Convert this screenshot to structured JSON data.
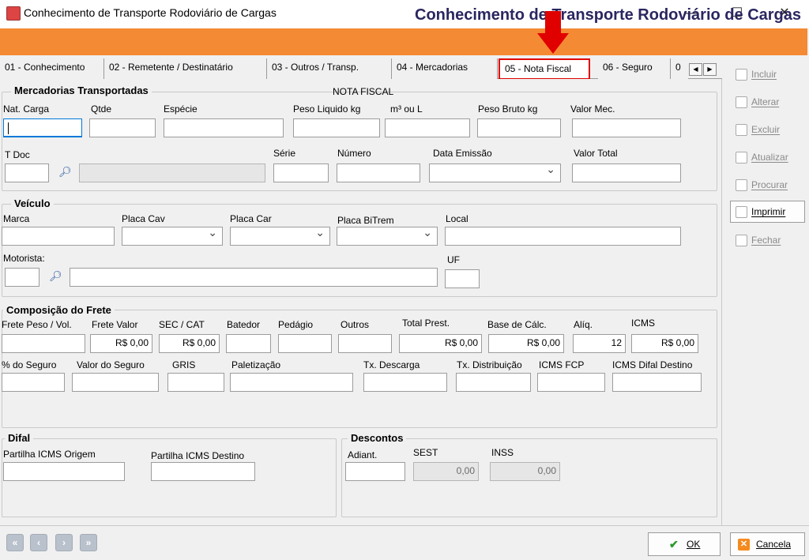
{
  "window": {
    "title": "Conhecimento de Transporte Rodoviário de Cargas",
    "minimize": "—",
    "maximize": "☐",
    "close": "✕"
  },
  "banner": {
    "title": "Conhecimento de Transporte Rodoviário de Cargas"
  },
  "tabs": [
    {
      "label": "01 - Conhecimento"
    },
    {
      "label": "02 - Remetente / Destinatário"
    },
    {
      "label": "03 - Outros / Transp."
    },
    {
      "label": "04 - Mercadorias"
    },
    {
      "label": "05 - Nota Fiscal",
      "active": true
    },
    {
      "label": "06 - Seguro"
    },
    {
      "label": "0"
    }
  ],
  "tab_scroll": {
    "left": "◀",
    "right": "▶"
  },
  "mercadorias": {
    "title": "Mercadorias Transportadas",
    "nota_fiscal_header": "NOTA FISCAL",
    "nat_carga": {
      "label": "Nat. Carga",
      "value": ""
    },
    "qtde": {
      "label": "Qtde",
      "value": ""
    },
    "especie": {
      "label": "Espécie",
      "value": ""
    },
    "peso_liquido": {
      "label": "Peso Liquido kg",
      "value": ""
    },
    "m3_ou_l": {
      "label": "m³ ou L",
      "value": ""
    },
    "peso_bruto": {
      "label": "Peso Bruto kg",
      "value": ""
    },
    "valor_mec": {
      "label": "Valor Mec.",
      "value": ""
    },
    "t_doc": {
      "label": "T Doc",
      "value": ""
    },
    "serie": {
      "label": "Série",
      "value": ""
    },
    "numero": {
      "label": "Número",
      "value": ""
    },
    "data_emissao": {
      "label": "Data Emissão",
      "value": ""
    },
    "valor_total": {
      "label": "Valor Total",
      "value": ""
    }
  },
  "veiculo": {
    "title": "Veículo",
    "marca": {
      "label": "Marca",
      "value": ""
    },
    "placa_cav": {
      "label": "Placa Cav",
      "value": ""
    },
    "placa_car": {
      "label": "Placa Car",
      "value": ""
    },
    "placa_bitrem": {
      "label": "Placa BiTrem",
      "value": ""
    },
    "local": {
      "label": "Local",
      "value": ""
    },
    "motorista": {
      "label": "Motorista:",
      "value": ""
    },
    "uf": {
      "label": "UF",
      "value": ""
    }
  },
  "frete": {
    "title": "Composição do Frete",
    "frete_peso_vol": {
      "label": "Frete Peso / Vol.",
      "value": ""
    },
    "frete_valor": {
      "label": "Frete Valor",
      "value": "R$ 0,00"
    },
    "sec_cat": {
      "label": "SEC / CAT",
      "value": "R$ 0,00"
    },
    "batedor": {
      "label": "Batedor",
      "value": ""
    },
    "pedagio": {
      "label": "Pedágio",
      "value": ""
    },
    "outros": {
      "label": "Outros",
      "value": ""
    },
    "total_prest": {
      "label": "Total Prest.",
      "value": "R$ 0,00"
    },
    "base_calc": {
      "label": "Base de Cálc.",
      "value": "R$ 0,00"
    },
    "aliq": {
      "label": "Alíq.",
      "value": "12"
    },
    "icms": {
      "label": "ICMS",
      "value": "R$ 0,00"
    },
    "pct_seguro": {
      "label": "% do Seguro",
      "value": ""
    },
    "valor_seguro": {
      "label": "Valor do Seguro",
      "value": ""
    },
    "gris": {
      "label": "GRIS",
      "value": ""
    },
    "paletizacao": {
      "label": "Paletização",
      "value": ""
    },
    "tx_descarga": {
      "label": "Tx. Descarga",
      "value": ""
    },
    "tx_distribuicao": {
      "label": "Tx. Distribuição",
      "value": ""
    },
    "icms_fcp": {
      "label": "ICMS FCP",
      "value": ""
    },
    "icms_difal_destino": {
      "label": "ICMS Difal Destino",
      "value": ""
    }
  },
  "difal": {
    "title": "Difal",
    "partilha_origem": {
      "label": "Partilha ICMS Origem",
      "value": ""
    },
    "partilha_destino": {
      "label": "Partilha ICMS Destino",
      "value": ""
    }
  },
  "descontos": {
    "title": "Descontos",
    "adiant": {
      "label": "Adiant.",
      "value": ""
    },
    "sest": {
      "label": "SEST",
      "value": "0,00"
    },
    "inss": {
      "label": "INSS",
      "value": "0,00"
    }
  },
  "sidebar": {
    "incluir": "Incluir",
    "alterar": "Alterar",
    "excluir": "Excluir",
    "atualizar": "Atualizar",
    "procurar": "Procurar",
    "imprimir": "Imprimir",
    "fechar": "Fechar"
  },
  "nav": {
    "first": "«",
    "prev": "‹",
    "next": "›",
    "last": "»"
  },
  "footer": {
    "ok": "OK",
    "cancela": "Cancela"
  },
  "colors": {
    "banner": "#f58a34",
    "banner_text": "#2a2660",
    "highlight": "#e00000"
  }
}
